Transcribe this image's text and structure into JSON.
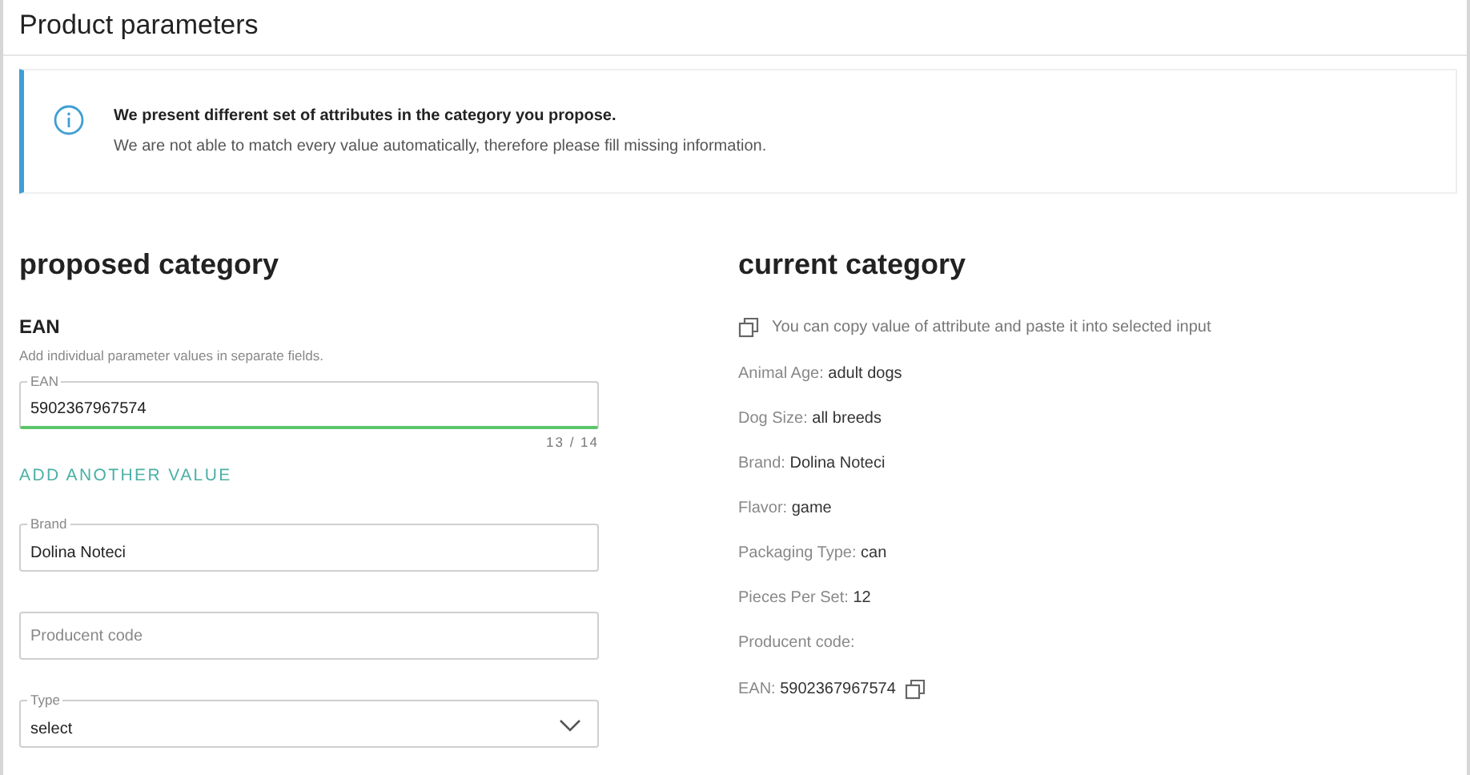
{
  "title": "Product parameters",
  "notice": {
    "heading": "We present different set of attributes in the category you propose.",
    "text": "We are not able to match every value automatically, therefore please fill missing information."
  },
  "proposed": {
    "heading": "proposed category",
    "group": {
      "title": "EAN",
      "hint": "Add individual parameter values in separate fields.",
      "field": {
        "label": "EAN",
        "value": "5902367967574",
        "counter": "13 / 14",
        "valid": true
      }
    },
    "add_button": "ADD ANOTHER VALUE",
    "fields": [
      {
        "kind": "text",
        "label": "Brand",
        "value": "Dolina Noteci"
      },
      {
        "kind": "text",
        "placeholder": "Producent code"
      },
      {
        "kind": "select",
        "label": "Type",
        "value": "select"
      }
    ]
  },
  "current": {
    "heading": "current category",
    "copy_hint": "You can copy value of attribute and paste it into selected input",
    "attributes": [
      {
        "name": "Animal Age:",
        "value": "adult dogs"
      },
      {
        "name": "Dog Size:",
        "value": "all breeds"
      },
      {
        "name": "Brand:",
        "value": "Dolina Noteci"
      },
      {
        "name": "Flavor:",
        "value": "game"
      },
      {
        "name": "Packaging Type:",
        "value": "can"
      },
      {
        "name": "Pieces Per Set:",
        "value": "12"
      },
      {
        "name": "Producent code:"
      },
      {
        "name": "EAN:",
        "value": "5902367967574",
        "copyable": true
      }
    ]
  }
}
